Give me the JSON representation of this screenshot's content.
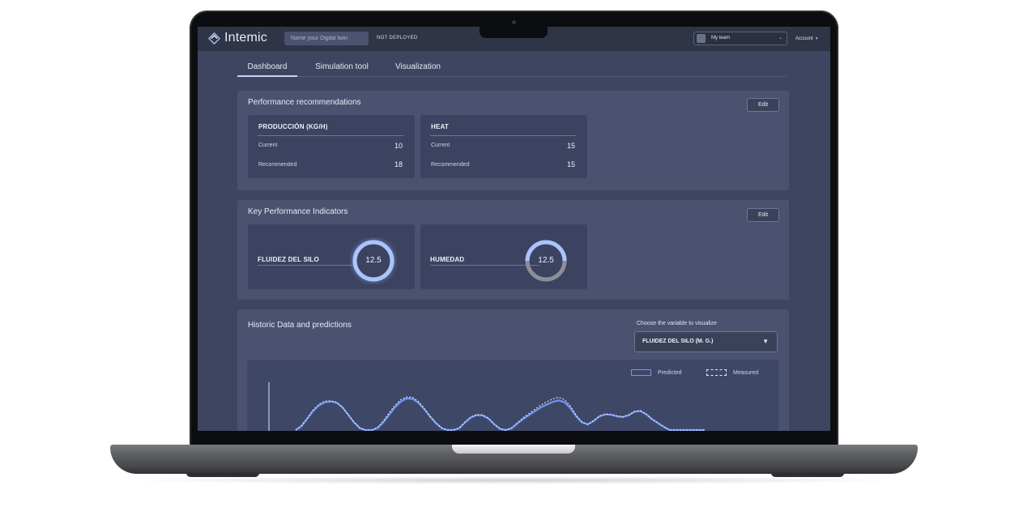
{
  "app": {
    "name": "Intemic",
    "twin_placeholder": "Name your Digital twin",
    "deploy_status": "NOT DEPLOYED",
    "team": "My team",
    "account": "Account"
  },
  "tabs": [
    {
      "label": "Dashboard",
      "active": true
    },
    {
      "label": "Simulation tool",
      "active": false
    },
    {
      "label": "Visualization",
      "active": false
    }
  ],
  "recommendations": {
    "title": "Performance recommendations",
    "edit_label": "Edit",
    "cards": [
      {
        "name": "PRODUCCIÓN (KG/H)",
        "current_label": "Current",
        "current": "10",
        "recommended_label": "Recommended",
        "recommended": "18"
      },
      {
        "name": "HEAT",
        "current_label": "Current",
        "current": "15",
        "recommended_label": "Recommended",
        "recommended": "15"
      }
    ]
  },
  "kpis": {
    "title": "Key Performance Indicators",
    "edit_label": "Edit",
    "items": [
      {
        "name": "FLUIDEZ DEL SILO",
        "value": "12.5",
        "fill": 1.0
      },
      {
        "name": "HUMEDAD",
        "value": "12.5",
        "fill": 0.5
      }
    ]
  },
  "historic": {
    "title": "Historic Data and predictions",
    "variable_caption": "Choose the variable to visualize",
    "selected_variable": "FLUIDEZ DEL SILO (M. G.)",
    "legend_predicted": "Predicted",
    "legend_measured": "Measured"
  },
  "colors": {
    "predicted": "#6f96f2",
    "measured": "#e8ecf6",
    "gauge_active": "#a9c4ff",
    "gauge_rest": "#8c8f99"
  },
  "chart_data": {
    "type": "line",
    "title": "",
    "xlabel": "",
    "ylabel": "",
    "grid": false,
    "legend": "top-right",
    "x": [
      0,
      1,
      2,
      3,
      4,
      5,
      6,
      7,
      8,
      9,
      10,
      11,
      12,
      13,
      14,
      15,
      16,
      17,
      18,
      19,
      20,
      21,
      22,
      23,
      24,
      25,
      26,
      27,
      28,
      29,
      30,
      31,
      32,
      33,
      34,
      35,
      36,
      37,
      38,
      39,
      40,
      41,
      42,
      43,
      44,
      45,
      46,
      47,
      48,
      49,
      50,
      51,
      52,
      53,
      54,
      55,
      56,
      57,
      58,
      59,
      60,
      61,
      62,
      63,
      64,
      65,
      66,
      67,
      68,
      69,
      70
    ],
    "ylim": [
      0,
      10
    ],
    "series": [
      {
        "name": "Predicted",
        "values": [
          0,
          1,
          3,
          5,
          6.5,
          7.3,
          7.5,
          7.2,
          6,
          4,
          2,
          0.5,
          0,
          0,
          0.5,
          2,
          4,
          6,
          7.5,
          8.3,
          8.2,
          7.2,
          5.5,
          3.5,
          1.8,
          0.5,
          0,
          0,
          0.5,
          2,
          3.3,
          3.9,
          3.8,
          3,
          1.5,
          0.3,
          0,
          0.5,
          1.8,
          3,
          4,
          5,
          6,
          6.7,
          7.4,
          7.8,
          7.3,
          5.8,
          3.6,
          2,
          1.5,
          2.4,
          3.6,
          4.1,
          4,
          3.6,
          3.4,
          3.9,
          4.8,
          5,
          4.1,
          2.8,
          1.8,
          0.8,
          0,
          0,
          0,
          0,
          0,
          0,
          0
        ]
      },
      {
        "name": "Measured",
        "values": [
          0,
          1.2,
          3.2,
          5.3,
          6.8,
          7.6,
          7.7,
          7.3,
          6,
          4,
          2,
          0.5,
          0,
          0,
          0.7,
          2.4,
          4.5,
          6.5,
          8,
          8.7,
          8.6,
          7.5,
          5.7,
          3.7,
          1.9,
          0.5,
          0,
          0,
          0.6,
          2.2,
          3.5,
          4.1,
          4,
          3.1,
          1.5,
          0.3,
          0,
          0.6,
          2,
          3.3,
          4.4,
          5.5,
          6.6,
          7.4,
          8.2,
          8.6,
          8,
          6.3,
          3.9,
          2.1,
          1.5,
          2.5,
          3.7,
          4.2,
          4.1,
          3.7,
          3.5,
          4,
          4.9,
          5.1,
          4.2,
          2.9,
          1.9,
          0.9,
          0,
          0,
          0,
          0,
          0,
          0,
          0
        ]
      }
    ]
  }
}
